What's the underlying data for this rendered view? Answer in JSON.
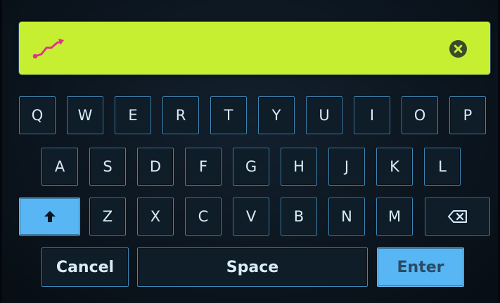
{
  "search": {
    "value": "",
    "placeholder": ""
  },
  "icons": {
    "input": "trending-line-icon",
    "clear": "clear-icon",
    "shift": "shift-arrow-icon",
    "backspace": "backspace-icon"
  },
  "colors": {
    "input_bg": "#c6ef31",
    "accent": "#57b6f3",
    "key_border": "#3e86b3",
    "icon_pink": "#e0338d"
  },
  "keyboard": {
    "row1": [
      "Q",
      "W",
      "E",
      "R",
      "T",
      "Y",
      "U",
      "I",
      "O",
      "P"
    ],
    "row2": [
      "A",
      "S",
      "D",
      "F",
      "G",
      "H",
      "J",
      "K",
      "L"
    ],
    "row3": [
      "Z",
      "X",
      "C",
      "V",
      "B",
      "N",
      "M"
    ],
    "cancel_label": "Cancel",
    "space_label": "Space",
    "enter_label": "Enter"
  }
}
